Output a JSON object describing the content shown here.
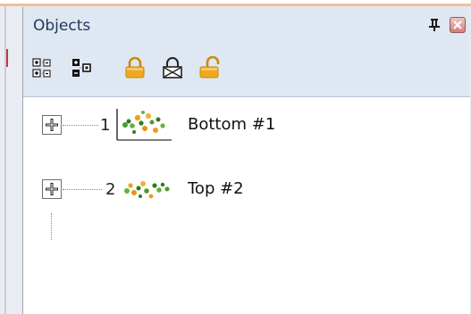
{
  "panel": {
    "title": "Objects",
    "pin_icon": "pin-icon",
    "close_icon": "close-icon"
  },
  "toolbar": {
    "buttons": [
      {
        "name": "expand-all-button",
        "icon": "expand-all-icon"
      },
      {
        "name": "collapse-all-button",
        "icon": "collapse-all-icon"
      },
      {
        "name": "lock-button",
        "icon": "lock-icon"
      },
      {
        "name": "lock-disabled-button",
        "icon": "lock-crossed-icon"
      },
      {
        "name": "unlock-button",
        "icon": "unlock-icon"
      }
    ]
  },
  "objects": [
    {
      "index": "1",
      "label": "Bottom #1",
      "thumbnail": "embroidery-flowers-thumbnail"
    },
    {
      "index": "2",
      "label": "Top #2",
      "thumbnail": "embroidery-flowers-thumbnail"
    }
  ],
  "colors": {
    "panel_bg": "#dfe7f2",
    "title_text": "#1e395b",
    "lock_gold": "#f0a820",
    "close_red": "#d87c7c"
  }
}
